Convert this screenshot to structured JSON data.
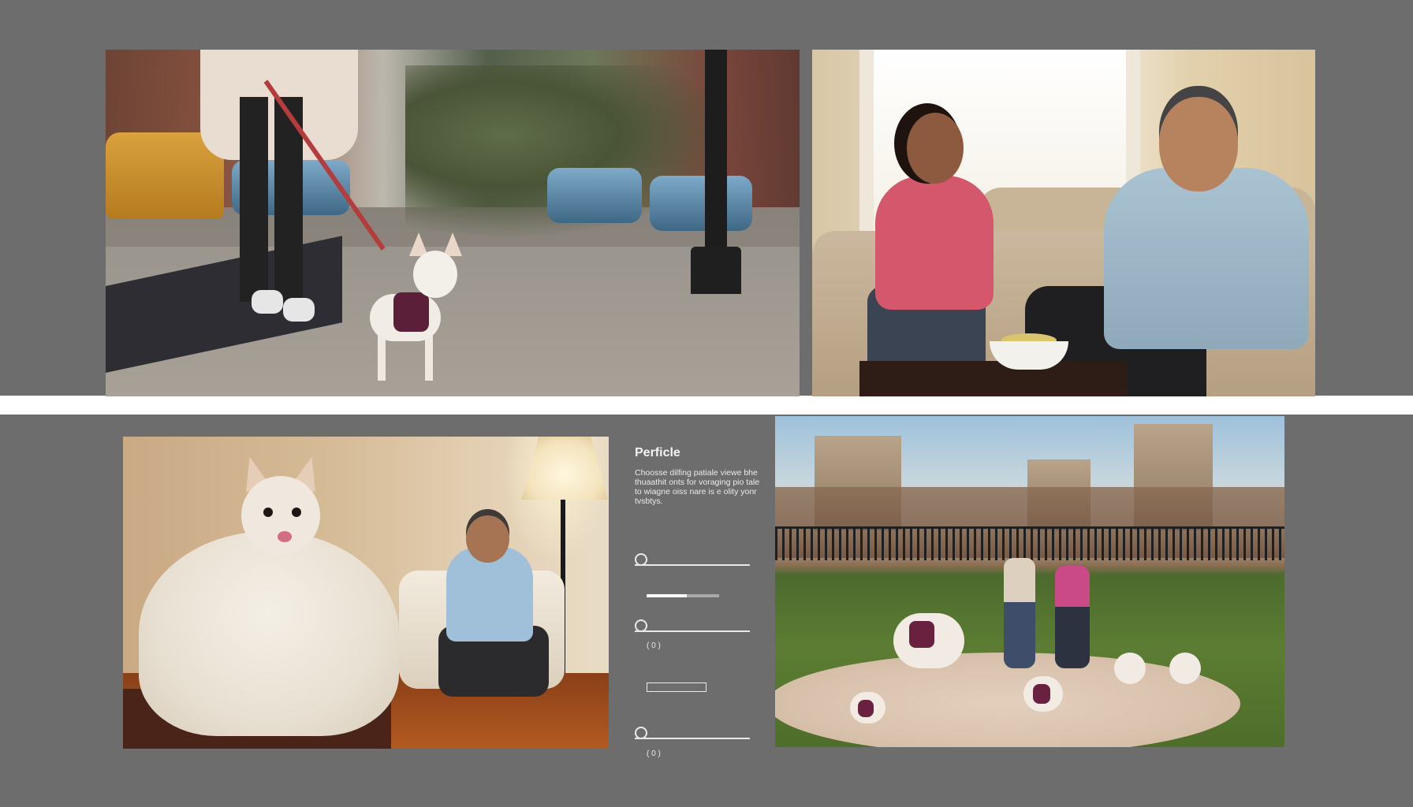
{
  "controls": {
    "title": "Perficle",
    "description": "Choosse dilfing patiale viewe bhe thuaathit onts for voraging pio tale to wiagne oiss nare is e olity yonr tvsbtys.",
    "slider1": {
      "fill": 0.0
    },
    "mini_progress": {
      "fill": 0.55
    },
    "slider2": {
      "fill": 0.0,
      "readout": "( 0 )"
    },
    "slider3": {
      "fill": 0.0,
      "readout": "( 0 )"
    }
  },
  "colors": {
    "background": "#6d6d6d",
    "divider": "#ffffff",
    "control_line": "#eaeaea"
  },
  "panels": [
    {
      "name": "street-walk-photo",
      "icon": "photo"
    },
    {
      "name": "living-room-conversation-photo",
      "icon": "photo"
    },
    {
      "name": "chihuahua-blanket-photo",
      "icon": "photo"
    },
    {
      "name": "park-dogs-photo",
      "icon": "photo"
    }
  ]
}
